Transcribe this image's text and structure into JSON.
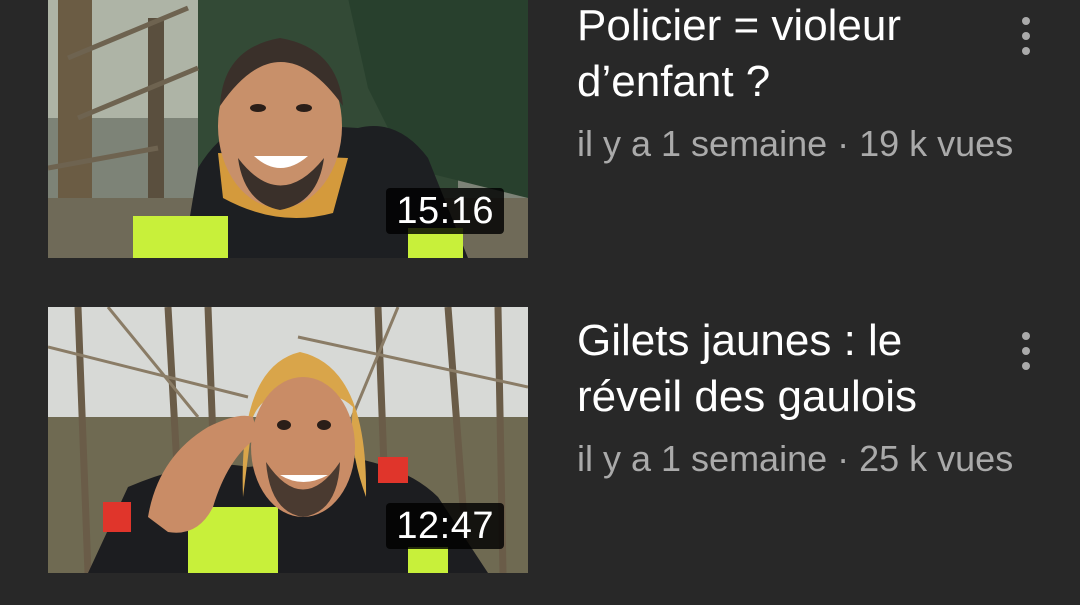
{
  "videos": [
    {
      "title_line1": "Policier = violeur",
      "title_line2": "d’enfant ?",
      "meta": "il y a 1 semaine · 19 k vues",
      "duration": "15:16",
      "thumbnail_icon": "man-in-hood-forest-thumbnail",
      "menu_icon": "more-vert-icon"
    },
    {
      "title_line1": "Gilets jaunes : le",
      "title_line2": "réveil des gaulois",
      "meta": "il y a 1 semaine · 25 k vues",
      "duration": "12:47",
      "thumbnail_icon": "man-yellow-hood-waving-thumbnail",
      "menu_icon": "more-vert-icon"
    }
  ],
  "colors": {
    "background": "#282828",
    "title": "#ffffff",
    "meta": "#aaaaaa",
    "duration_bg": "#000000",
    "vest": "#c8f03a",
    "hood": "#d9a54a"
  }
}
